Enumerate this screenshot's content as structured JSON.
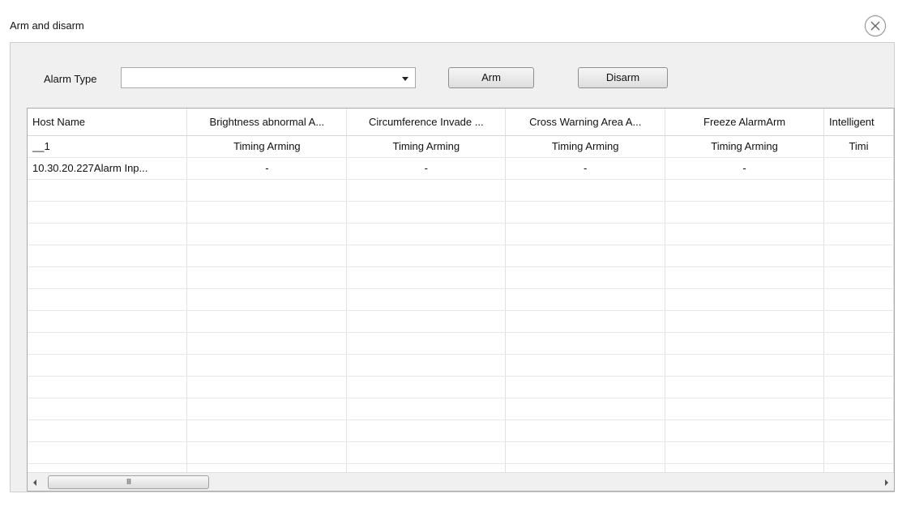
{
  "window": {
    "title": "Arm and disarm",
    "close_icon": "close-circle-icon"
  },
  "toolbar": {
    "alarm_type_label": "Alarm Type",
    "alarm_type_value": "",
    "arm_label": "Arm",
    "disarm_label": "Disarm"
  },
  "table": {
    "columns": [
      "Host Name",
      "Brightness abnormal A...",
      "Circumference Invade ...",
      "Cross Warning Area A...",
      "Freeze AlarmArm",
      "Intelligent"
    ],
    "rows": [
      [
        "__1",
        "Timing Arming",
        "Timing Arming",
        "Timing Arming",
        "Timing Arming",
        "Timi"
      ],
      [
        "10.30.20.227Alarm Inp...",
        "-",
        "-",
        "-",
        "-",
        ""
      ]
    ],
    "empty_row_count": 14
  },
  "scrollbar": {
    "thumb_grip": "III",
    "left_icon": "scroll-left-arrow-icon",
    "right_icon": "scroll-right-arrow-icon"
  }
}
